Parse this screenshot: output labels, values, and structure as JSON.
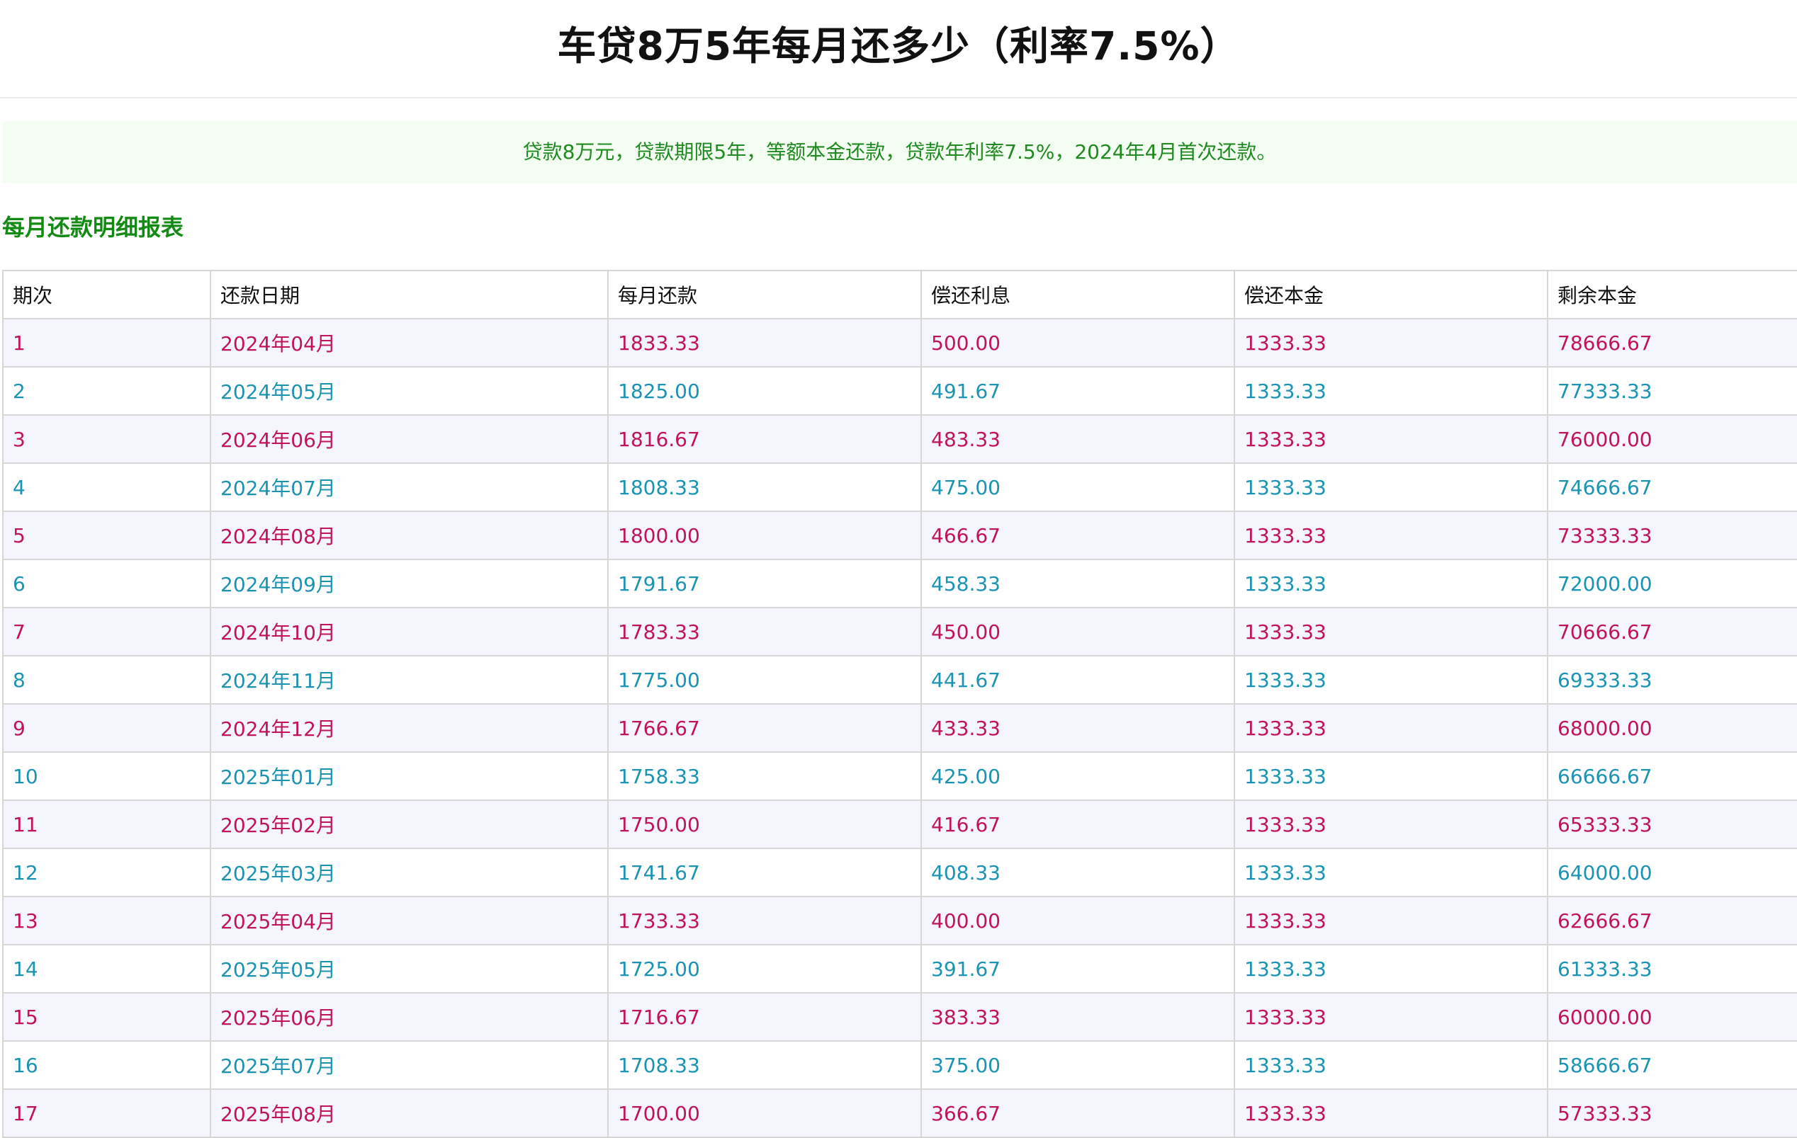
{
  "page": {
    "title": "车贷8万5年每月还多少（利率7.5%）",
    "summary": "贷款8万元，贷款期限5年，等额本金还款，贷款年利率7.5%，2024年4月首次还款。",
    "section_title": "每月还款明细报表"
  },
  "colors": {
    "summary_text": "#1f8a1f",
    "summary_background": "#f4fdf1",
    "section_title": "#138a13",
    "odd_row_text": "#c01458",
    "even_row_text": "#1b93b2",
    "odd_row_background": "#f4f5fd"
  },
  "table": {
    "headers": [
      "期次",
      "还款日期",
      "每月还款",
      "偿还利息",
      "偿还本金",
      "剩余本金"
    ],
    "rows": [
      [
        "1",
        "2024年04月",
        "1833.33",
        "500.00",
        "1333.33",
        "78666.67"
      ],
      [
        "2",
        "2024年05月",
        "1825.00",
        "491.67",
        "1333.33",
        "77333.33"
      ],
      [
        "3",
        "2024年06月",
        "1816.67",
        "483.33",
        "1333.33",
        "76000.00"
      ],
      [
        "4",
        "2024年07月",
        "1808.33",
        "475.00",
        "1333.33",
        "74666.67"
      ],
      [
        "5",
        "2024年08月",
        "1800.00",
        "466.67",
        "1333.33",
        "73333.33"
      ],
      [
        "6",
        "2024年09月",
        "1791.67",
        "458.33",
        "1333.33",
        "72000.00"
      ],
      [
        "7",
        "2024年10月",
        "1783.33",
        "450.00",
        "1333.33",
        "70666.67"
      ],
      [
        "8",
        "2024年11月",
        "1775.00",
        "441.67",
        "1333.33",
        "69333.33"
      ],
      [
        "9",
        "2024年12月",
        "1766.67",
        "433.33",
        "1333.33",
        "68000.00"
      ],
      [
        "10",
        "2025年01月",
        "1758.33",
        "425.00",
        "1333.33",
        "66666.67"
      ],
      [
        "11",
        "2025年02月",
        "1750.00",
        "416.67",
        "1333.33",
        "65333.33"
      ],
      [
        "12",
        "2025年03月",
        "1741.67",
        "408.33",
        "1333.33",
        "64000.00"
      ],
      [
        "13",
        "2025年04月",
        "1733.33",
        "400.00",
        "1333.33",
        "62666.67"
      ],
      [
        "14",
        "2025年05月",
        "1725.00",
        "391.67",
        "1333.33",
        "61333.33"
      ],
      [
        "15",
        "2025年06月",
        "1716.67",
        "383.33",
        "1333.33",
        "60000.00"
      ],
      [
        "16",
        "2025年07月",
        "1708.33",
        "375.00",
        "1333.33",
        "58666.67"
      ],
      [
        "17",
        "2025年08月",
        "1700.00",
        "366.67",
        "1333.33",
        "57333.33"
      ]
    ]
  }
}
